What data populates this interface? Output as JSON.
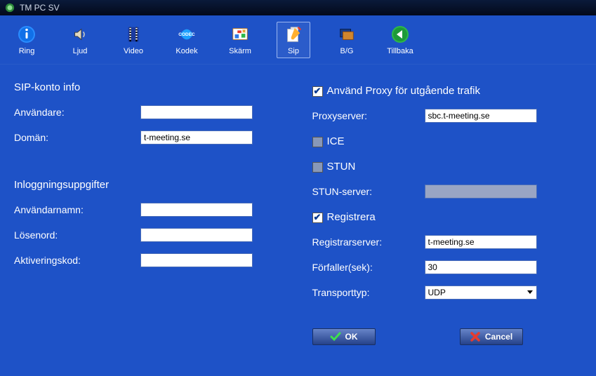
{
  "window": {
    "title": "TM PC SV"
  },
  "toolbar": {
    "items": [
      {
        "id": "ring",
        "label": "Ring"
      },
      {
        "id": "ljud",
        "label": "Ljud"
      },
      {
        "id": "video",
        "label": "Video"
      },
      {
        "id": "kodek",
        "label": "Kodek"
      },
      {
        "id": "skarm",
        "label": "Skärm"
      },
      {
        "id": "sip",
        "label": "Sip",
        "selected": true
      },
      {
        "id": "bg",
        "label": "B/G"
      },
      {
        "id": "tillbaka",
        "label": "Tillbaka"
      }
    ]
  },
  "left": {
    "section1_title": "SIP-konto info",
    "user_label": "Användare:",
    "user_value": "",
    "domain_label": "Domän:",
    "domain_value": "t-meeting.se",
    "section2_title": "Inloggningsuppgifter",
    "username_label": "Användarnamn:",
    "username_value": "",
    "password_label": "Lösenord:",
    "password_value": "",
    "activation_label": "Aktiveringskod:",
    "activation_value": ""
  },
  "right": {
    "proxy_cb_label": "Använd Proxy för utgående trafik",
    "proxy_checked": true,
    "proxyserver_label": "Proxyserver:",
    "proxyserver_value": "sbc.t-meeting.se",
    "ice_label": "ICE",
    "ice_checked": false,
    "stun_label": "STUN",
    "stun_checked": false,
    "stunserver_label": "STUN-server:",
    "stunserver_value": "",
    "reg_label": "Registrera",
    "reg_checked": true,
    "regserver_label": "Registrarserver:",
    "regserver_value": "t-meeting.se",
    "expires_label": "Förfaller(sek):",
    "expires_value": "30",
    "transport_label": "Transporttyp:",
    "transport_value": "UDP"
  },
  "buttons": {
    "ok": "OK",
    "cancel": "Cancel"
  }
}
